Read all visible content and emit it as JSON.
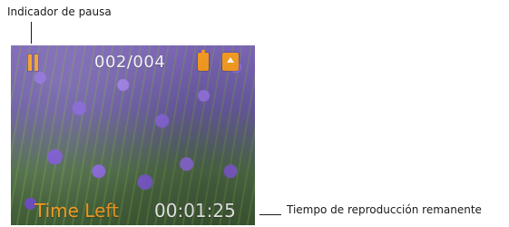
{
  "annotations": {
    "pause_indicator_label": "Indicador de pausa",
    "remaining_time_label": "Tiempo de reproducción remanente"
  },
  "screen": {
    "track_counter": "002/004",
    "time_left_label": "Time Left",
    "time_left_value": "00:01:25",
    "icons": {
      "pause": "pause-icon",
      "battery": "battery-icon",
      "memory_card": "memory-card-icon"
    },
    "colors": {
      "accent_orange": "#f39a22",
      "overlay_white": "#ffffff"
    }
  }
}
